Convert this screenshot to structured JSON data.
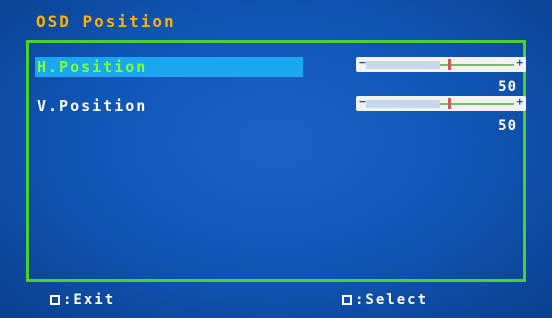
{
  "osd": {
    "title": "OSD Position",
    "items": [
      {
        "label": "H.Position",
        "value": "50",
        "level": 0.5,
        "selected": true
      },
      {
        "label": "V.Position",
        "value": "50",
        "level": 0.5,
        "selected": false
      }
    ]
  },
  "footer": {
    "exit_label": ":Exit",
    "select_label": ":Select"
  },
  "colors": {
    "background": "#0f54b3",
    "title": "#ffb000",
    "border": "#4cd02a",
    "selected_bg": "#1aa7ef",
    "selected_text": "#7dff3c"
  }
}
